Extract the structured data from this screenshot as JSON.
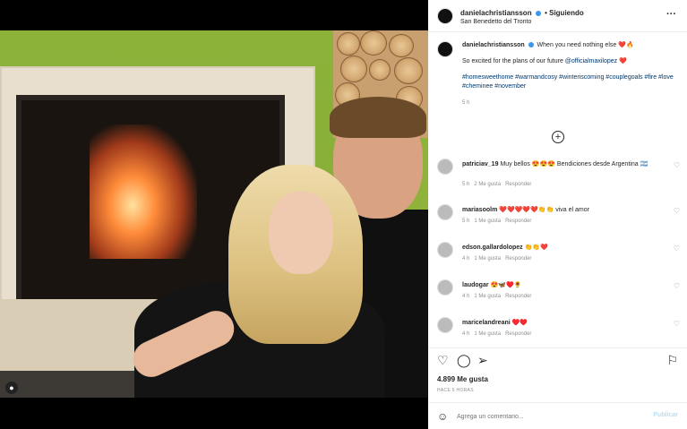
{
  "post": {
    "username": "danielachristiansson",
    "follow_status": "Siguiendo",
    "location": "San Benedetto del Tronto",
    "more_icon": "more-dots-icon"
  },
  "caption": {
    "username": "danielachristiansson",
    "line1": "When you need nothing else ❤️🔥",
    "line2_text": "So excited for the plans of our future ",
    "line2_tag": "@officialmaxilopez",
    "line2_end": " ❤️",
    "hashtags": "#homesweethome #warmandcosy #winteriscoming #couplegoals #fire #love #cheminee #november",
    "time": "5 h"
  },
  "comments": [
    {
      "user": "patriciav_19",
      "text": "Muy bellos 😍😍😍 Bendiciones desde Argentina 🇦🇷",
      "time": "5 h",
      "likes": "2 Me gusta",
      "reply": "Responder"
    },
    {
      "user": "mariasoolm",
      "text": "❤️❤️❤️❤️❤️👏👏 viva el amor",
      "time": "5 h",
      "likes": "1 Me gusta",
      "reply": "Responder"
    },
    {
      "user": "edson.gallardolopez",
      "text": "👏👏❤️",
      "time": "4 h",
      "likes": "1 Me gusta",
      "reply": "Responder"
    },
    {
      "user": "laudogar",
      "text": "😍🦋♥️🌻",
      "time": "4 h",
      "likes": "1 Me gusta",
      "reply": "Responder"
    },
    {
      "user": "maricelandreani",
      "text": "♥️♥️",
      "time": "4 h",
      "likes": "1 Me gusta",
      "reply": "Responder"
    }
  ],
  "actions": {
    "likes": "4.899 Me gusta",
    "ago": "HACE 5 HORAS"
  },
  "composer": {
    "placeholder": "Agrega un comentario...",
    "post_label": "Publicar"
  }
}
